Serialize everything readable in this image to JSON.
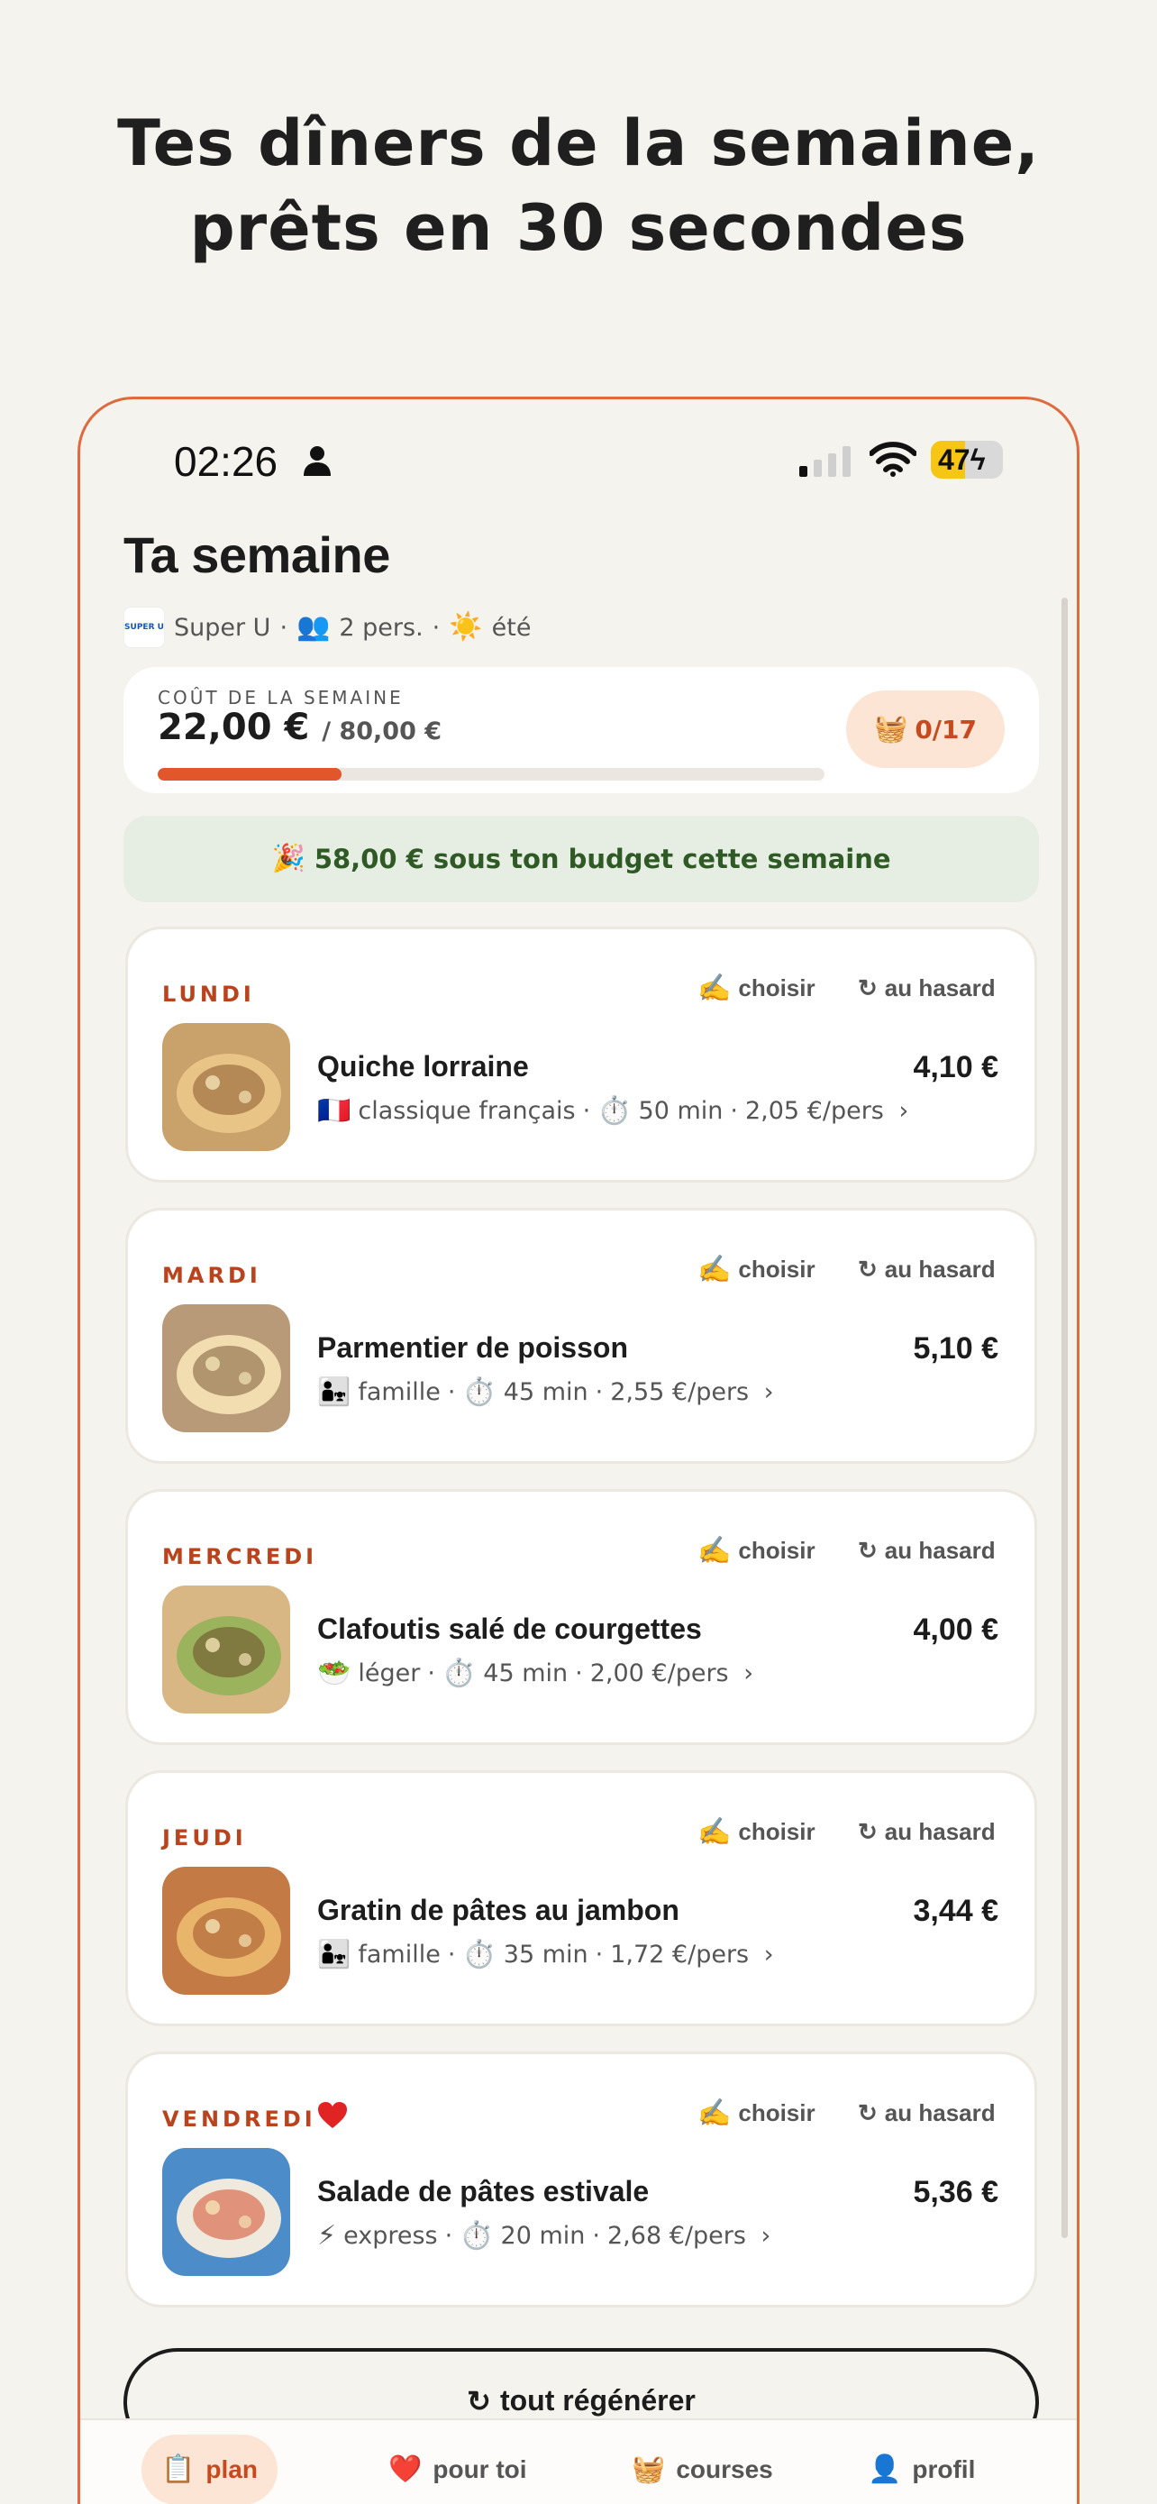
{
  "headline": {
    "line1": "Tes dîners de la semaine,",
    "line2": "prêts en 30 secondes"
  },
  "status_bar": {
    "time": "02:26",
    "battery": "47",
    "battery_level": 0.47
  },
  "header": {
    "title": "Ta semaine",
    "store_logo_text": "SUPER U",
    "store": "Super U",
    "persons": "2 pers.",
    "season": "été",
    "sep": "·"
  },
  "cost": {
    "label": "COÛT DE LA SEMAINE",
    "value": "22,00 €",
    "budget": "/ 80,00 €",
    "progress": 0.275,
    "basket_count": "0/17"
  },
  "savings": {
    "text": "58,00 € sous ton budget cette semaine"
  },
  "actions": {
    "choose": "choisir",
    "random": "au hasard"
  },
  "days": [
    {
      "day": "LUNDI",
      "name": "Quiche lorraine",
      "price": "4,10 €",
      "tag_icon": "france-flag-icon",
      "tag": "classique français",
      "time": "50 min",
      "per_person": "2,05 €/pers",
      "favorite": false
    },
    {
      "day": "MARDI",
      "name": "Parmentier de poisson",
      "price": "5,10 €",
      "tag_icon": "family-icon",
      "tag": "famille",
      "time": "45 min",
      "per_person": "2,55 €/pers",
      "favorite": false
    },
    {
      "day": "MERCREDI",
      "name": "Clafoutis salé de courgettes",
      "price": "4,00 €",
      "tag_icon": "salad-icon",
      "tag": "léger",
      "time": "45 min",
      "per_person": "2,00 €/pers",
      "favorite": false
    },
    {
      "day": "JEUDI",
      "name": "Gratin de pâtes au jambon",
      "price": "3,44 €",
      "tag_icon": "family-icon",
      "tag": "famille",
      "time": "35 min",
      "per_person": "1,72 €/pers",
      "favorite": false
    },
    {
      "day": "VENDREDI",
      "name": "Salade de pâtes estivale",
      "price": "5,36 €",
      "tag_icon": "lightning-icon",
      "tag": "express",
      "time": "20 min",
      "per_person": "2,68 €/pers",
      "favorite": true
    }
  ],
  "regenerate": "tout régénérer",
  "tabs": [
    {
      "label": "plan",
      "icon": "clipboard-icon",
      "active": true
    },
    {
      "label": "pour toi",
      "icon": "heart-icon",
      "active": false
    },
    {
      "label": "courses",
      "icon": "basket-icon",
      "active": false
    },
    {
      "label": "profil",
      "icon": "user-icon",
      "active": false
    }
  ],
  "colors": {
    "accent": "#e1562a",
    "day_label": "#b8431c",
    "savings_text": "#2f5a26",
    "battery": "#f7c614"
  }
}
